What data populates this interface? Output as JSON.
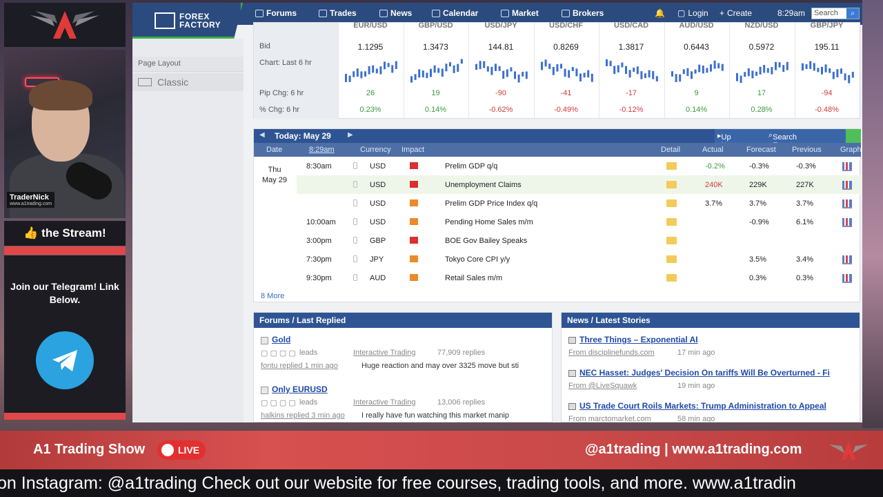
{
  "stream": {
    "streamer_name": "TraderNick",
    "streamer_site": "www.a1trading.com",
    "thumbs_text": "👍 the Stream!",
    "telegram_text": "Join our Telegram! Link Below.",
    "show_title": "A1 Trading Show",
    "live_label": "LIVE",
    "handle": "@a1trading | www.a1trading.com",
    "ticker": "on Instagram: @a1trading Check out our website for free courses, trading tools, and more. www.a1tradin"
  },
  "ff": {
    "logo_line1": "FOREX",
    "logo_line2": "FACTORY",
    "nav": [
      "Forums",
      "Trades",
      "News",
      "Calendar",
      "Market",
      "Brokers"
    ],
    "login": "Login",
    "create": "Create",
    "time": "8:29am",
    "search_placeholder": "Search",
    "page_layout_label": "Page Layout",
    "layout_value": "Classic"
  },
  "market": {
    "labels": [
      "Bid",
      "Chart: Last 6 hr",
      "Pip Chg: 6 hr",
      "% Chg: 6 hr"
    ],
    "pairs": [
      {
        "pair": "EUR/USD",
        "bid": "1.1295",
        "pip": "26",
        "pct": "0.23%",
        "dir": "up"
      },
      {
        "pair": "GBP/USD",
        "bid": "1.3473",
        "pip": "19",
        "pct": "0.14%",
        "dir": "up"
      },
      {
        "pair": "USD/JPY",
        "bid": "144.81",
        "pip": "-90",
        "pct": "-0.62%",
        "dir": "down"
      },
      {
        "pair": "USD/CHF",
        "bid": "0.8269",
        "pip": "-41",
        "pct": "-0.49%",
        "dir": "down"
      },
      {
        "pair": "USD/CAD",
        "bid": "1.3817",
        "pip": "-17",
        "pct": "-0.12%",
        "dir": "down"
      },
      {
        "pair": "AUD/USD",
        "bid": "0.6443",
        "pip": "9",
        "pct": "0.14%",
        "dir": "up"
      },
      {
        "pair": "NZD/USD",
        "bid": "0.5972",
        "pip": "17",
        "pct": "0.28%",
        "dir": "up"
      },
      {
        "pair": "GBP/JPY",
        "bid": "195.11",
        "pip": "-94",
        "pct": "-0.48%",
        "dir": "down"
      }
    ]
  },
  "calendar": {
    "today": "Today: May 29",
    "up_next": "Up Next",
    "search_events": "Search Events",
    "columns": [
      "Date",
      "8:29am",
      "Currency",
      "Impact",
      "Detail",
      "Actual",
      "Forecast",
      "Previous",
      "Graph"
    ],
    "day_name": "Thu",
    "day_date": "May 29",
    "events": [
      {
        "time": "8:30am",
        "currency": "USD",
        "impact": "red",
        "event": "Prelim GDP q/q",
        "actual": "-0.2%",
        "actual_color": "green",
        "forecast": "-0.3%",
        "previous": "-0.3%",
        "graph": true
      },
      {
        "time": "",
        "currency": "USD",
        "impact": "red",
        "event": "Unemployment Claims",
        "actual": "240K",
        "actual_color": "red",
        "forecast": "229K",
        "previous": "227K",
        "graph": true
      },
      {
        "time": "",
        "currency": "USD",
        "impact": "orange",
        "event": "Prelim GDP Price Index q/q",
        "actual": "3.7%",
        "actual_color": "plain",
        "forecast": "3.7%",
        "previous": "3.7%",
        "graph": true
      },
      {
        "time": "10:00am",
        "currency": "USD",
        "impact": "orange",
        "event": "Pending Home Sales m/m",
        "actual": "",
        "actual_color": "plain",
        "forecast": "-0.9%",
        "previous": "6.1%",
        "graph": true
      },
      {
        "time": "3:00pm",
        "currency": "GBP",
        "impact": "red",
        "event": "BOE Gov Bailey Speaks",
        "actual": "",
        "actual_color": "plain",
        "forecast": "",
        "previous": "",
        "graph": false
      },
      {
        "time": "7:30pm",
        "currency": "JPY",
        "impact": "orange",
        "event": "Tokyo Core CPI y/y",
        "actual": "",
        "actual_color": "plain",
        "forecast": "3.5%",
        "previous": "3.4%",
        "graph": true
      },
      {
        "time": "9:30pm",
        "currency": "AUD",
        "impact": "orange",
        "event": "Retail Sales m/m",
        "actual": "",
        "actual_color": "plain",
        "forecast": "0.3%",
        "previous": "0.3%",
        "graph": true
      }
    ],
    "more": "8 More"
  },
  "forums": {
    "title": "Forums / Last Replied",
    "threads": [
      {
        "title": "Gold",
        "tag": "leads",
        "forum": "Interactive Trading",
        "replies": "77,909 replies",
        "replier": "fontu replied 1 min ago",
        "snippet": "Huge reaction and may over 3325 move but sti"
      },
      {
        "title": "Only EURUSD",
        "tag": "leads",
        "forum": "Interactive Trading",
        "replies": "13,006 replies",
        "replier": "halkins replied 3 min ago",
        "snippet": "I really have fun watching this market manip"
      }
    ]
  },
  "news": {
    "title": "News / Latest Stories",
    "stories": [
      {
        "title": "Three Things – Exponential AI",
        "source": "From disciplinefunds.com",
        "age": "17 min ago"
      },
      {
        "title": "NEC Hasset: Judges' Decision On tariffs Will Be Overturned - Fi",
        "source": "From @LiveSquawk",
        "age": "19 min ago"
      },
      {
        "title": "US Trade Court Roils Markets: Trump Administration to Appeal",
        "source": "From marctomarket.com",
        "age": "58 min ago"
      }
    ]
  },
  "colors": {
    "ff_blue": "#2b4a7e",
    "header_blue": "#2f5493",
    "accent_green": "#3ab04a",
    "positive": "#3a9a3a",
    "negative": "#d23a3a",
    "brand_red": "#d85050",
    "telegram_blue": "#2aa3e0"
  }
}
